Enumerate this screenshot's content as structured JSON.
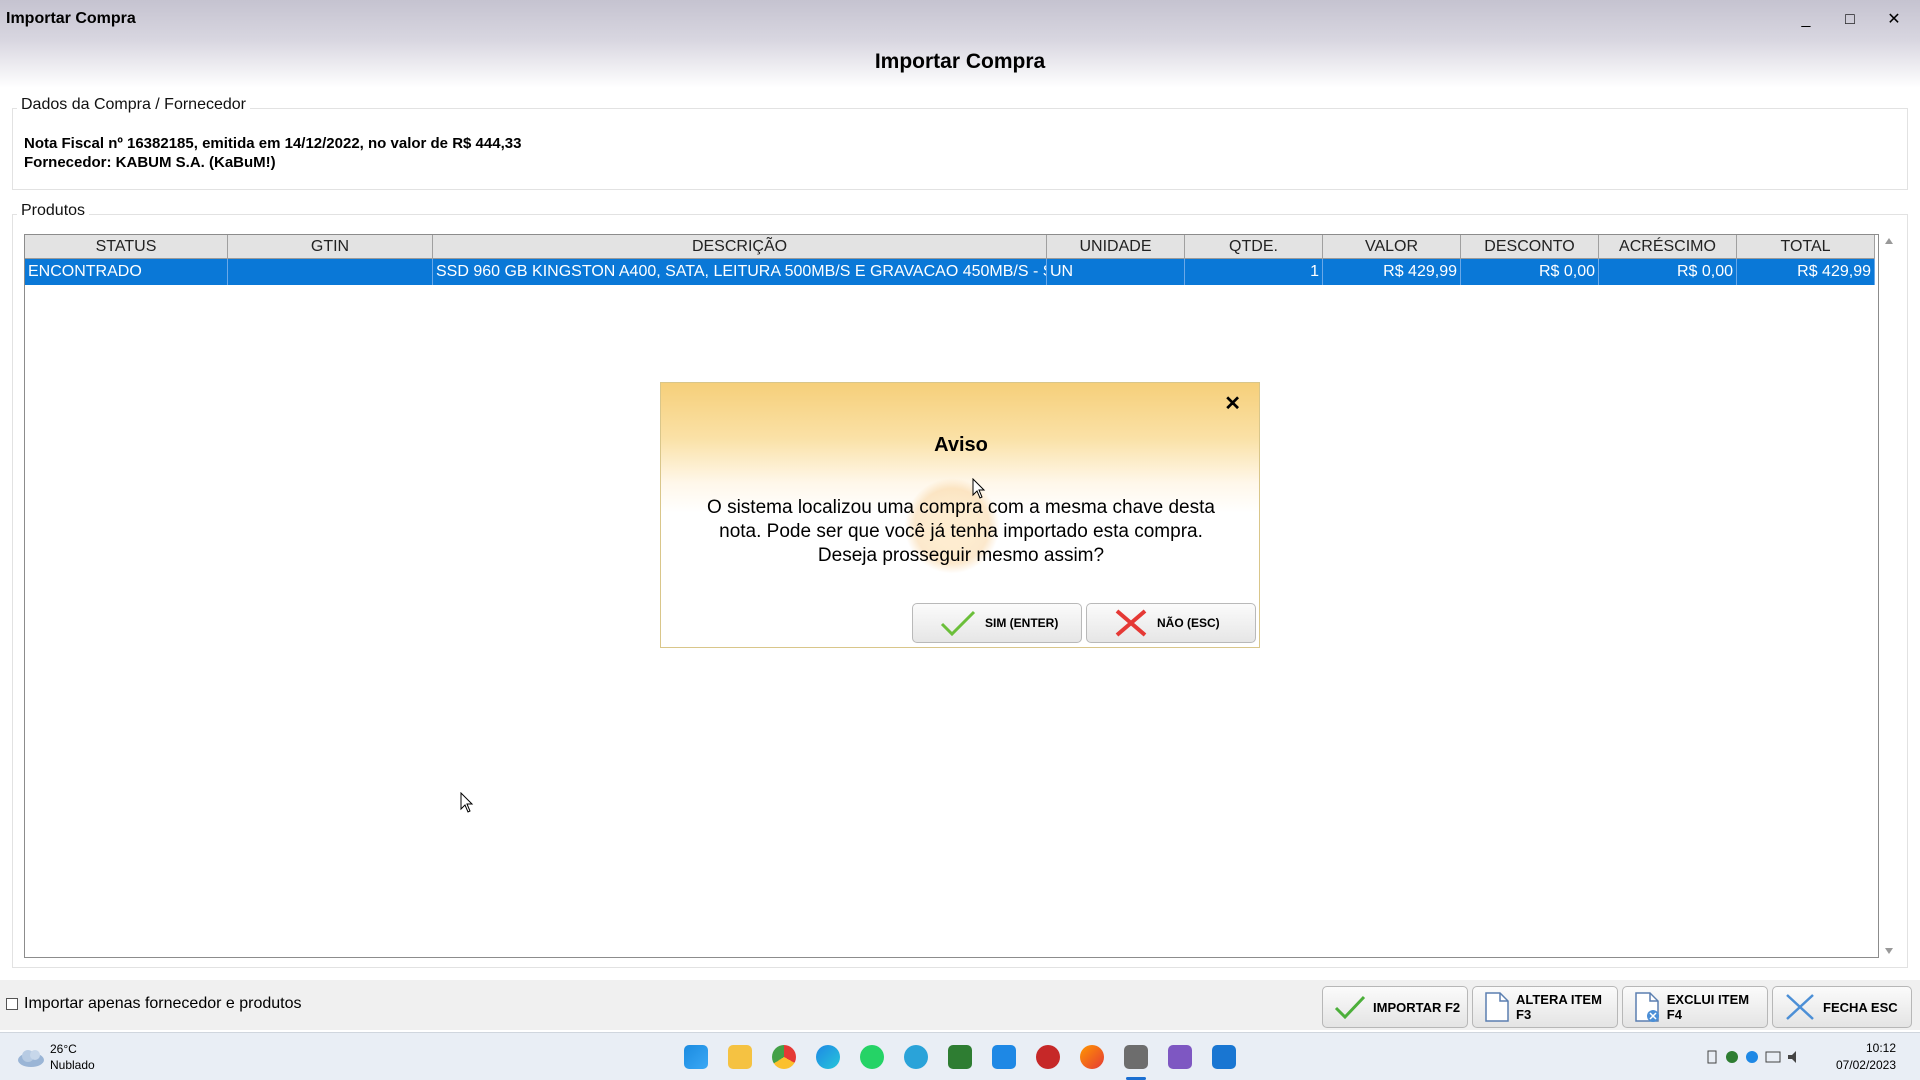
{
  "window": {
    "title": "Importar Compra",
    "minimize": "_",
    "maximize": "□",
    "close": "✕"
  },
  "header": {
    "title": "Importar Compra"
  },
  "purchase": {
    "legend": "Dados da Compra / Fornecedor",
    "nota_line": "Nota Fiscal nº 16382185, emitida em 14/12/2022, no valor de R$ 444,33",
    "supplier_line": "Fornecedor: KABUM S.A. (KaBuM!)"
  },
  "products": {
    "legend": "Produtos",
    "columns": [
      "STATUS",
      "GTIN",
      "DESCRIÇÃO",
      "UNIDADE",
      "QTDE.",
      "VALOR",
      "DESCONTO",
      "ACRÉSCIMO",
      "TOTAL"
    ],
    "rows": [
      {
        "status": "ENCONTRADO",
        "gtin": "",
        "descricao": "SSD 960 GB KINGSTON A400, SATA, LEITURA 500MB/S E GRAVACAO 450MB/S - S",
        "unidade": "UN",
        "qtde": "1",
        "valor": "R$ 429,99",
        "desconto": "R$ 0,00",
        "acrescimo": "R$ 0,00",
        "total": "R$ 429,99"
      }
    ]
  },
  "footer": {
    "checkbox_label": "Importar apenas fornecedor e produtos",
    "checkbox_checked": false,
    "buttons": {
      "importar": "IMPORTAR F2",
      "altera": "ALTERA ITEM F3",
      "exclui": "EXCLUI ITEM F4",
      "fecha": "FECHA ESC"
    }
  },
  "dialog": {
    "close": "✕",
    "title": "Aviso",
    "message_line1": "O sistema localizou uma compra com a mesma chave desta",
    "message_line2": "nota. Pode ser que você já tenha importado esta compra.",
    "message_line3": "Deseja prosseguir mesmo assim?",
    "yes_label": "SIM (ENTER)",
    "no_label": "NÃO (ESC)"
  },
  "taskbar": {
    "weather_temp": "26°C",
    "weather_desc": "Nublado",
    "time": "10:12",
    "date": "07/02/2023",
    "icons": [
      "windows-start-icon",
      "file-explorer-icon",
      "chrome-icon",
      "edge-icon",
      "whatsapp-icon",
      "telegram-icon",
      "spreadsheet-icon",
      "mail-icon",
      "app-icon",
      "firefox-icon",
      "active-app-icon",
      "media-icon",
      "notepad-icon"
    ]
  },
  "colors": {
    "selection": "#0a78d7",
    "dialog_header": "#f6cf7a",
    "titlebar": "#c5c3d0"
  }
}
